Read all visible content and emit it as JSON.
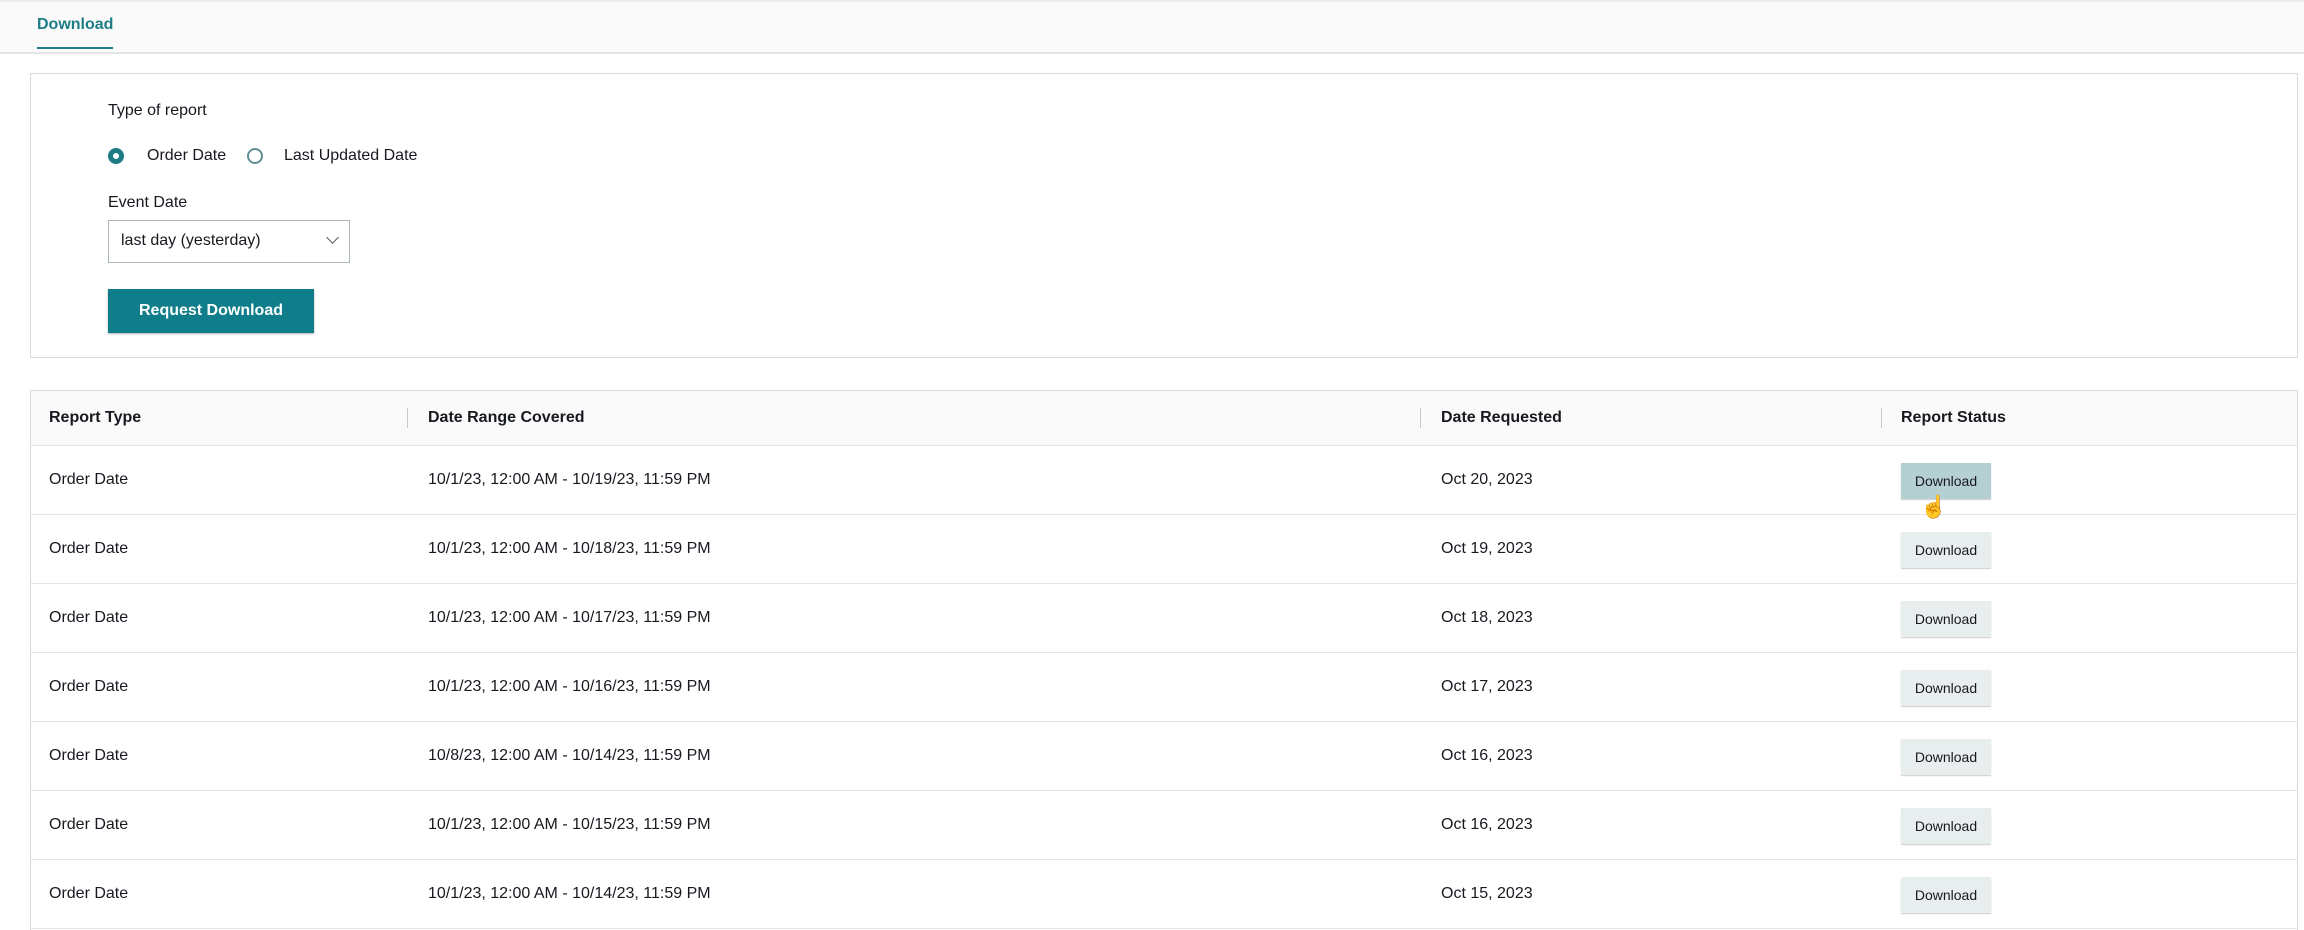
{
  "tabs": [
    {
      "label": "Download"
    }
  ],
  "form": {
    "type_label": "Type of report",
    "radio_options": [
      {
        "label": "Order Date",
        "selected": true
      },
      {
        "label": "Last Updated Date",
        "selected": false
      }
    ],
    "event_date_label": "Event Date",
    "event_date_value": "last day (yesterday)",
    "request_button": "Request Download"
  },
  "table": {
    "headers": [
      "Report Type",
      "Date Range Covered",
      "Date Requested",
      "Report Status"
    ],
    "rows": [
      {
        "type": "Order Date",
        "range": "10/1/23, 12:00 AM - 10/19/23, 11:59 PM",
        "requested": "Oct 20, 2023",
        "status": "Download"
      },
      {
        "type": "Order Date",
        "range": "10/1/23, 12:00 AM - 10/18/23, 11:59 PM",
        "requested": "Oct 19, 2023",
        "status": "Download"
      },
      {
        "type": "Order Date",
        "range": "10/1/23, 12:00 AM - 10/17/23, 11:59 PM",
        "requested": "Oct 18, 2023",
        "status": "Download"
      },
      {
        "type": "Order Date",
        "range": "10/1/23, 12:00 AM - 10/16/23, 11:59 PM",
        "requested": "Oct 17, 2023",
        "status": "Download"
      },
      {
        "type": "Order Date",
        "range": "10/8/23, 12:00 AM - 10/14/23, 11:59 PM",
        "requested": "Oct 16, 2023",
        "status": "Download"
      },
      {
        "type": "Order Date",
        "range": "10/1/23, 12:00 AM - 10/15/23, 11:59 PM",
        "requested": "Oct 16, 2023",
        "status": "Download"
      },
      {
        "type": "Order Date",
        "range": "10/1/23, 12:00 AM - 10/14/23, 11:59 PM",
        "requested": "Oct 15, 2023",
        "status": "Download"
      }
    ]
  },
  "colors": {
    "accent": "#0f7e8a"
  }
}
